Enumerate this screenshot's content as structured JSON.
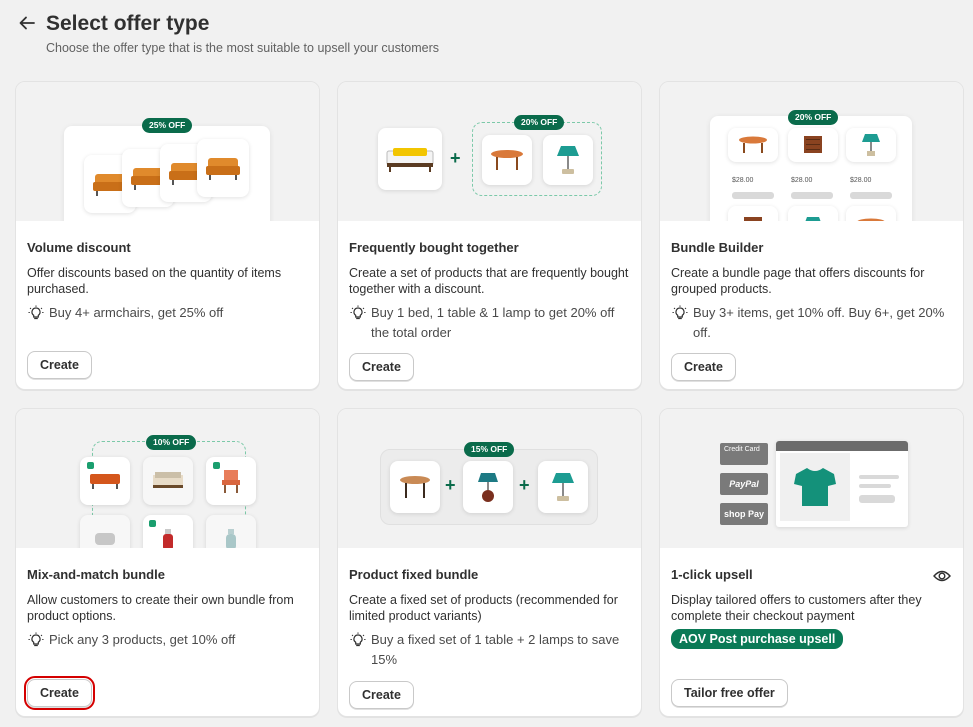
{
  "header": {
    "title": "Select offer type",
    "subtitle": "Choose the offer type that is the most suitable to upsell your customers"
  },
  "cards": [
    {
      "title": "Volume discount",
      "description": "Offer discounts based on the quantity of items purchased.",
      "tip": "Buy 4+ armchairs, get 25% off",
      "button": "Create",
      "badge": "25% OFF"
    },
    {
      "title": "Frequently bought together",
      "description": "Create a set of products that are frequently bought together with a discount.",
      "tip": "Buy 1 bed, 1 table & 1 lamp to get 20% off the total order",
      "button": "Create",
      "badge": "20% OFF"
    },
    {
      "title": "Bundle Builder",
      "description": "Create a bundle page that offers discounts for grouped products.",
      "tip": "Buy 3+ items, get 10% off. Buy 6+, get 20% off.",
      "button": "Create",
      "badge": "20% OFF",
      "prices": [
        "$28.00",
        "$28.00",
        "$28.00"
      ]
    },
    {
      "title": "Mix-and-match bundle",
      "description": "Allow customers to create their own bundle from product options.",
      "tip": "Pick any 3 products, get 10% off",
      "button": "Create",
      "badge": "10% OFF"
    },
    {
      "title": "Product fixed bundle",
      "description": "Create a fixed set of products (recommended for limited product variants)",
      "tip": "Buy a fixed set of 1 table + 2 lamps to save 15%",
      "button": "Create",
      "badge": "15% OFF"
    },
    {
      "title": "1-click upsell",
      "description": "Display tailored offers to customers after they complete their checkout payment",
      "tag": "AOV Post purchase upsell",
      "button": "Tailor free offer",
      "payments": [
        "Credit Card",
        "PayPal",
        "shop Pay"
      ]
    }
  ],
  "colors": {
    "accent": "#0a6b4b",
    "highlight": "#d40000"
  }
}
